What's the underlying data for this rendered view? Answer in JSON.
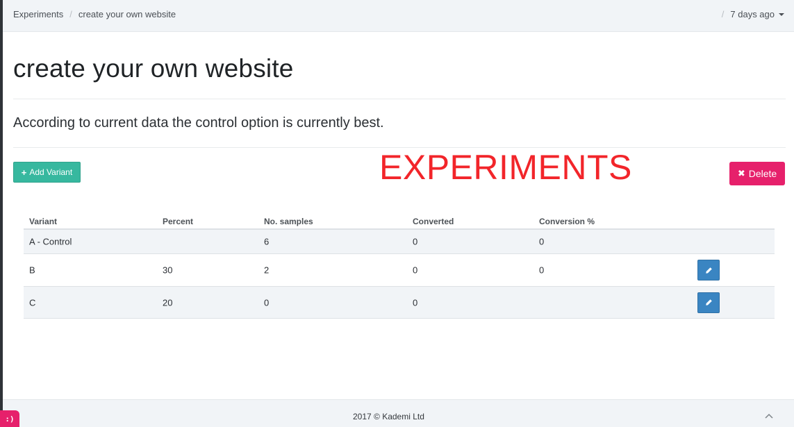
{
  "breadcrumb": {
    "root": "Experiments",
    "separator": "/",
    "current": "create your own website"
  },
  "topbar": {
    "separator": "/",
    "time_label": "7 days ago"
  },
  "page": {
    "title": "create your own website",
    "summary": "According to current data the control option is currently best."
  },
  "actions": {
    "add_variant_icon": "+",
    "add_variant_label": "Add Variant",
    "delete_icon": "✖",
    "delete_label": "Delete"
  },
  "annotation": {
    "text": "EXPERIMENTS",
    "color": "#f2252a"
  },
  "table": {
    "columns": [
      "Variant",
      "Percent",
      "No. samples",
      "Converted",
      "Conversion %"
    ],
    "rows": [
      {
        "variant": "A - Control",
        "percent": "",
        "samples": "6",
        "converted": "0",
        "conversion": "0",
        "editable": false
      },
      {
        "variant": "B",
        "percent": "30",
        "samples": "2",
        "converted": "0",
        "conversion": "0",
        "editable": true
      },
      {
        "variant": "C",
        "percent": "20",
        "samples": "0",
        "converted": "0",
        "conversion": "",
        "editable": true
      }
    ]
  },
  "footer": {
    "text": "2017 © Kademi Ltd",
    "badge": ":)"
  },
  "colors": {
    "add_button": "#37b89f",
    "delete_button": "#e6206b",
    "edit_button": "#3a85c2",
    "bar_background": "#f1f4f7"
  },
  "icons": {
    "add": "plus-icon",
    "delete": "times-icon",
    "edit": "pencil-icon",
    "dropdown": "caret-down-icon",
    "scroll_top": "chevron-up-icon"
  }
}
